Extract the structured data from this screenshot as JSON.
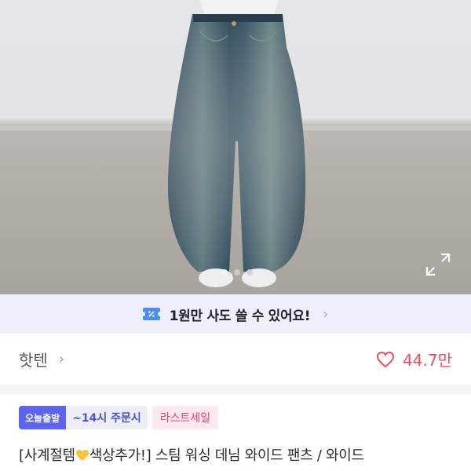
{
  "gallery": {
    "image_alt": "wide leg washed denim jeans",
    "dot_count": 3,
    "active_dot": 0
  },
  "promo": {
    "text": "1원만 사도 쓸 수 있어요!",
    "icon": "coupon-icon"
  },
  "shop": {
    "name": "핫텐",
    "likes": "44.7만"
  },
  "badges": {
    "delivery": "오늘출발",
    "deadline": "~14시 주문시",
    "sale": "라스트세일"
  },
  "product": {
    "title_prefix": "[사계절템",
    "title_suffix": "색상추가!] 스팀 워싱 데님 와이드 팬츠 / 와이드"
  },
  "colors": {
    "accent": "#5d63ee",
    "like": "#f04d5e",
    "sale": "#e6407a"
  }
}
